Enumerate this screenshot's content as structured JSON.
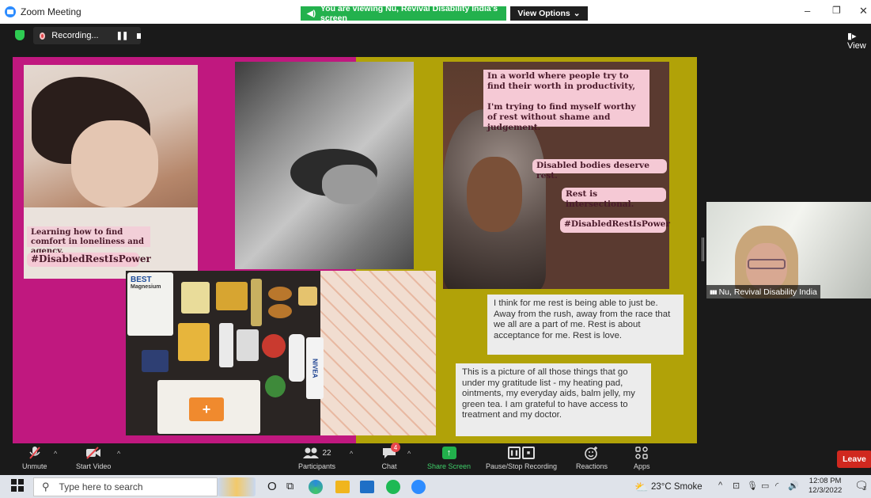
{
  "window": {
    "title": "Zoom Meeting",
    "share_banner": "You are viewing Nu, Revival Disability India's screen",
    "view_options": "View Options",
    "view_options_caret": "⌄",
    "minimize": "–",
    "restore": "❐",
    "close": "✕",
    "view_label": "View"
  },
  "recording": {
    "label": "Recording...",
    "pause_glyph": "❚❚"
  },
  "shared_content": {
    "left_quote_1": "Learning how to find comfort in loneliness and agency.",
    "left_hashtag": "#DisabledRestIsPower",
    "right_quote_main": "In a world where people try to find their worth in productivity,\n\nI'm trying to find myself worthy of rest without shame and judgement.",
    "right_quote_2": "Disabled bodies deserve rest.",
    "right_quote_3": "Rest is intersectional.",
    "right_hashtag": "#DisabledRestIsPower",
    "text_card_1": "I think for me rest is being able to just be. Away from the rush, away from the race that we all are a part of me. Rest is about acceptance for me. Rest is love.",
    "text_card_2": "This is a picture of all those things that go under my gratitude list - my heating pad, ointments, my everyday aids, balm jelly, my green tea. I am grateful to have access to treatment and my doctor.",
    "product_label_1": "BEST",
    "product_label_2": "Magnesium",
    "product_label_3": "NIVEA"
  },
  "participant_tile": {
    "name": "Nu, Revival Disability India",
    "signal_glyph": "▮▮▮"
  },
  "controls": {
    "unmute": "Unmute",
    "start_video": "Start Video",
    "participants": "Participants",
    "participant_count": "22",
    "chat": "Chat",
    "chat_badge": "4",
    "share_screen": "Share Screen",
    "pause_stop_recording": "Pause/Stop Recording",
    "reactions": "Reactions",
    "apps": "Apps",
    "leave": "Leave",
    "caret": "^"
  },
  "taskbar": {
    "search_placeholder": "Type here to search",
    "weather": "23°C  Smoke",
    "time": "12:08 PM",
    "date": "12/3/2022",
    "notification_count": "3"
  },
  "colors": {
    "pink_panel": "#c0187f",
    "olive_panel": "#b1a208",
    "share_banner": "#23b14d",
    "leave_button": "#d0281f",
    "recording_dot": "#e8474c"
  }
}
